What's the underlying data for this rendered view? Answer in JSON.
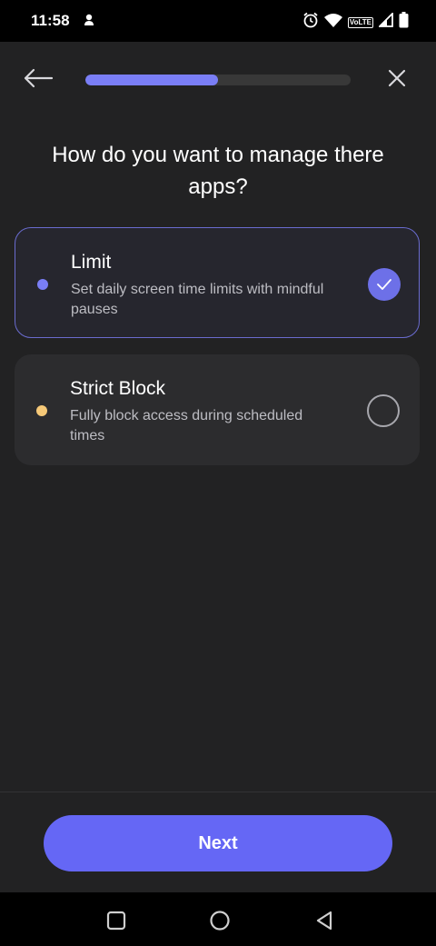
{
  "status_bar": {
    "time": "11:58",
    "lte_label": "VoLTE",
    "icons": [
      "person-icon",
      "alarm-icon",
      "wifi-icon",
      "lte-icon",
      "signal-icon",
      "battery-icon"
    ]
  },
  "header": {
    "back_icon": "arrow-left-icon",
    "close_icon": "close-icon",
    "progress_fraction": 0.5
  },
  "question": "How do you want to manage there apps?",
  "options": [
    {
      "title": "Limit",
      "description": "Set daily screen time limits with mindful pauses",
      "dot_color": "#7a7ef6",
      "selected": true
    },
    {
      "title": "Strict Block",
      "description": "Fully block access during scheduled times",
      "dot_color": "#f6c978",
      "selected": false
    }
  ],
  "footer": {
    "next_label": "Next"
  },
  "colors": {
    "accent": "#6567f5",
    "background": "#222223",
    "card": "#2c2c2e"
  },
  "nav_bar": {
    "icons": [
      "recents-square-icon",
      "home-circle-icon",
      "back-triangle-icon"
    ]
  }
}
